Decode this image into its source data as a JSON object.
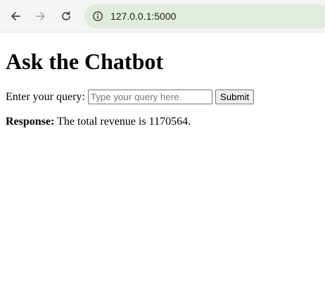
{
  "browser": {
    "url": "127.0.0.1:5000",
    "icons": {
      "back": "arrow-left-icon",
      "forward": "arrow-right-icon",
      "reload": "reload-icon",
      "site_info": "info-icon"
    }
  },
  "page": {
    "title": "Ask the Chatbot",
    "query_label": "Enter your query:",
    "query_placeholder": "Type your query here",
    "query_value": "",
    "submit_label": "Submit",
    "response_label": "Response:",
    "response_text": "The total revenue is 1170564."
  },
  "colors": {
    "browser_bar_bg": "#f3f6f2",
    "omnibox_bg": "#e1ebde"
  }
}
